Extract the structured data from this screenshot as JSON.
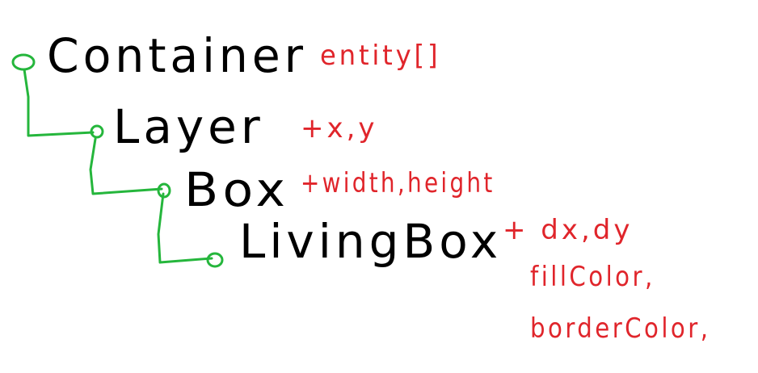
{
  "colors": {
    "tree_line": "#25b63c",
    "class_text": "#000000",
    "member_text": "#e0252b"
  },
  "nodes": [
    {
      "name": "Container",
      "members": "entity[]"
    },
    {
      "name": "Layer",
      "members": "+x,y"
    },
    {
      "name": "Box",
      "members": "+width,height"
    },
    {
      "name": "LivingBox",
      "members": "+ dx,dy",
      "extra": [
        "fillColor,",
        "borderColor,"
      ]
    }
  ]
}
